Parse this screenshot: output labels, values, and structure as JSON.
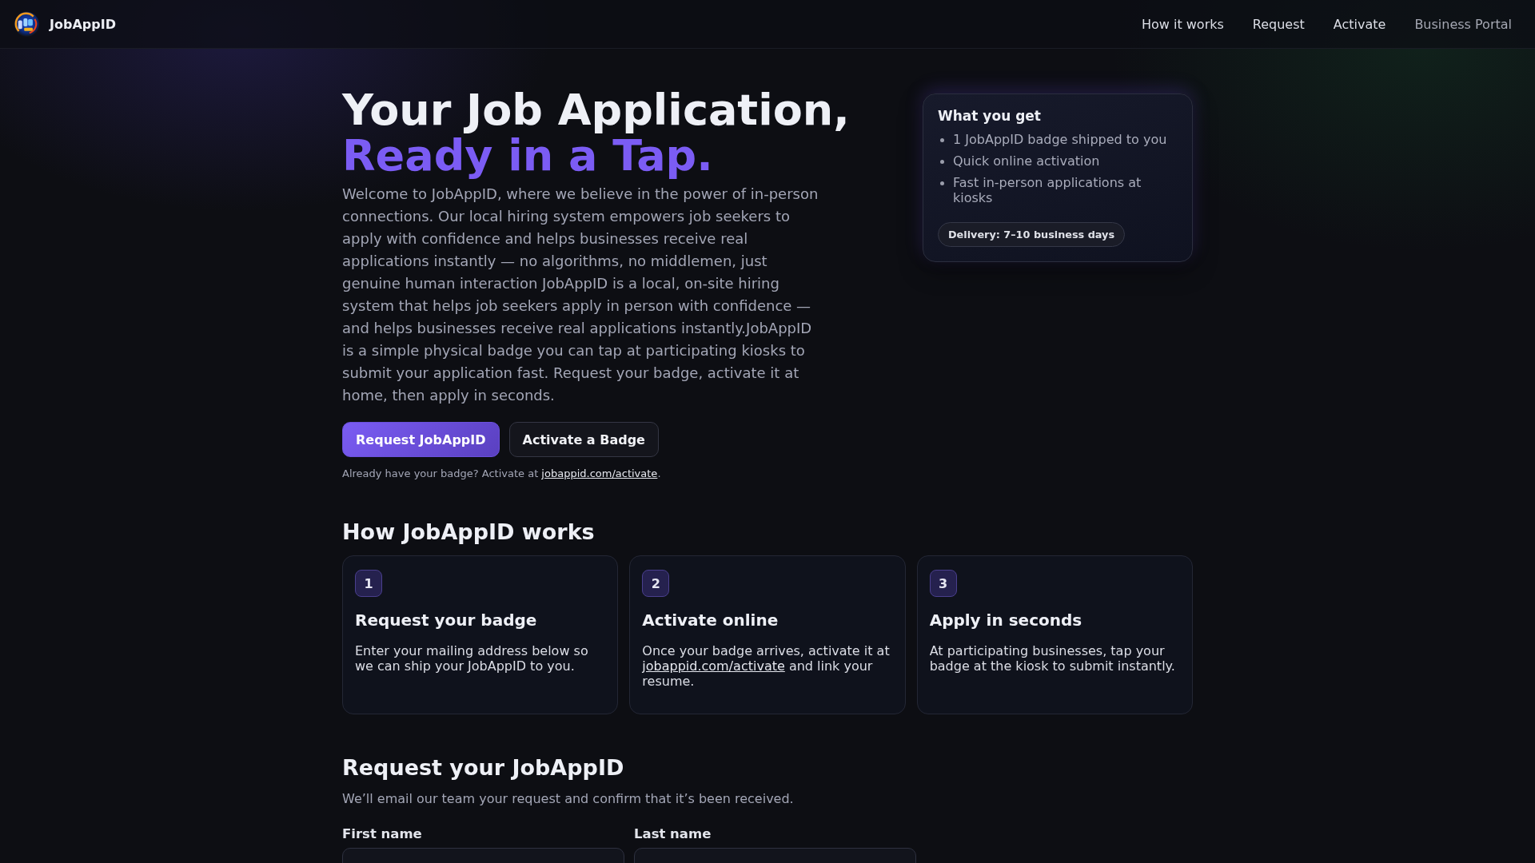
{
  "header": {
    "brand": "JobAppID",
    "nav": [
      {
        "label": "How it works",
        "kind": "page"
      },
      {
        "label": "Request",
        "kind": "page"
      },
      {
        "label": "Activate",
        "kind": "page"
      },
      {
        "label": "Business Portal",
        "kind": "portal"
      }
    ]
  },
  "hero": {
    "title": "Your Job Application,",
    "title_accent": "Ready in a Tap.",
    "intro": "Welcome to JobAppID, where we believe in the power of in-person connections. Our local hiring system empowers job seekers to apply with confidence and helps businesses receive real applications instantly — no algorithms, no middlemen, just genuine human interaction JobAppID is a local, on-site hiring system that helps job seekers apply in person with confidence — and helps businesses receive real applications instantly.JobAppID is a simple physical badge you can tap at participating kiosks to submit your application fast. Request your badge, activate it at home, then apply in seconds.",
    "buttons": [
      {
        "label": "Request JobAppID",
        "kind": "primary"
      },
      {
        "label": "Activate a Badge",
        "kind": "secondary"
      }
    ],
    "note": {
      "before": "Already have your badge? Activate at",
      "link": "jobappid.com/activate",
      "after": "."
    }
  },
  "offer_card": {
    "title": "What you get",
    "items": [
      "1 JobAppID badge shipped to you",
      "Quick online activation",
      "Fast in-person applications at kiosks"
    ],
    "pill": "Delivery: 7–10 business days"
  },
  "how_it_works": {
    "heading": "How JobAppID works",
    "steps": [
      {
        "number": "1",
        "title": "Request your badge",
        "text": "Enter your mailing address below so we can ship your JobAppID to you."
      },
      {
        "number": "2",
        "title": "Activate online",
        "text": "Once your badge arrives, activate it at",
        "link": "jobappid.com/activate",
        "text_after": "and link your resume."
      },
      {
        "number": "3",
        "title": "Apply in seconds",
        "text": "At participating businesses, tap your badge at the kiosk to submit instantly."
      }
    ]
  },
  "request_form": {
    "heading": "Request your JobAppID",
    "subtitle": "We’ll email our team your request and confirm that it’s been received.",
    "fields": [
      {
        "label": "First name"
      },
      {
        "label": "Last name"
      }
    ]
  }
}
